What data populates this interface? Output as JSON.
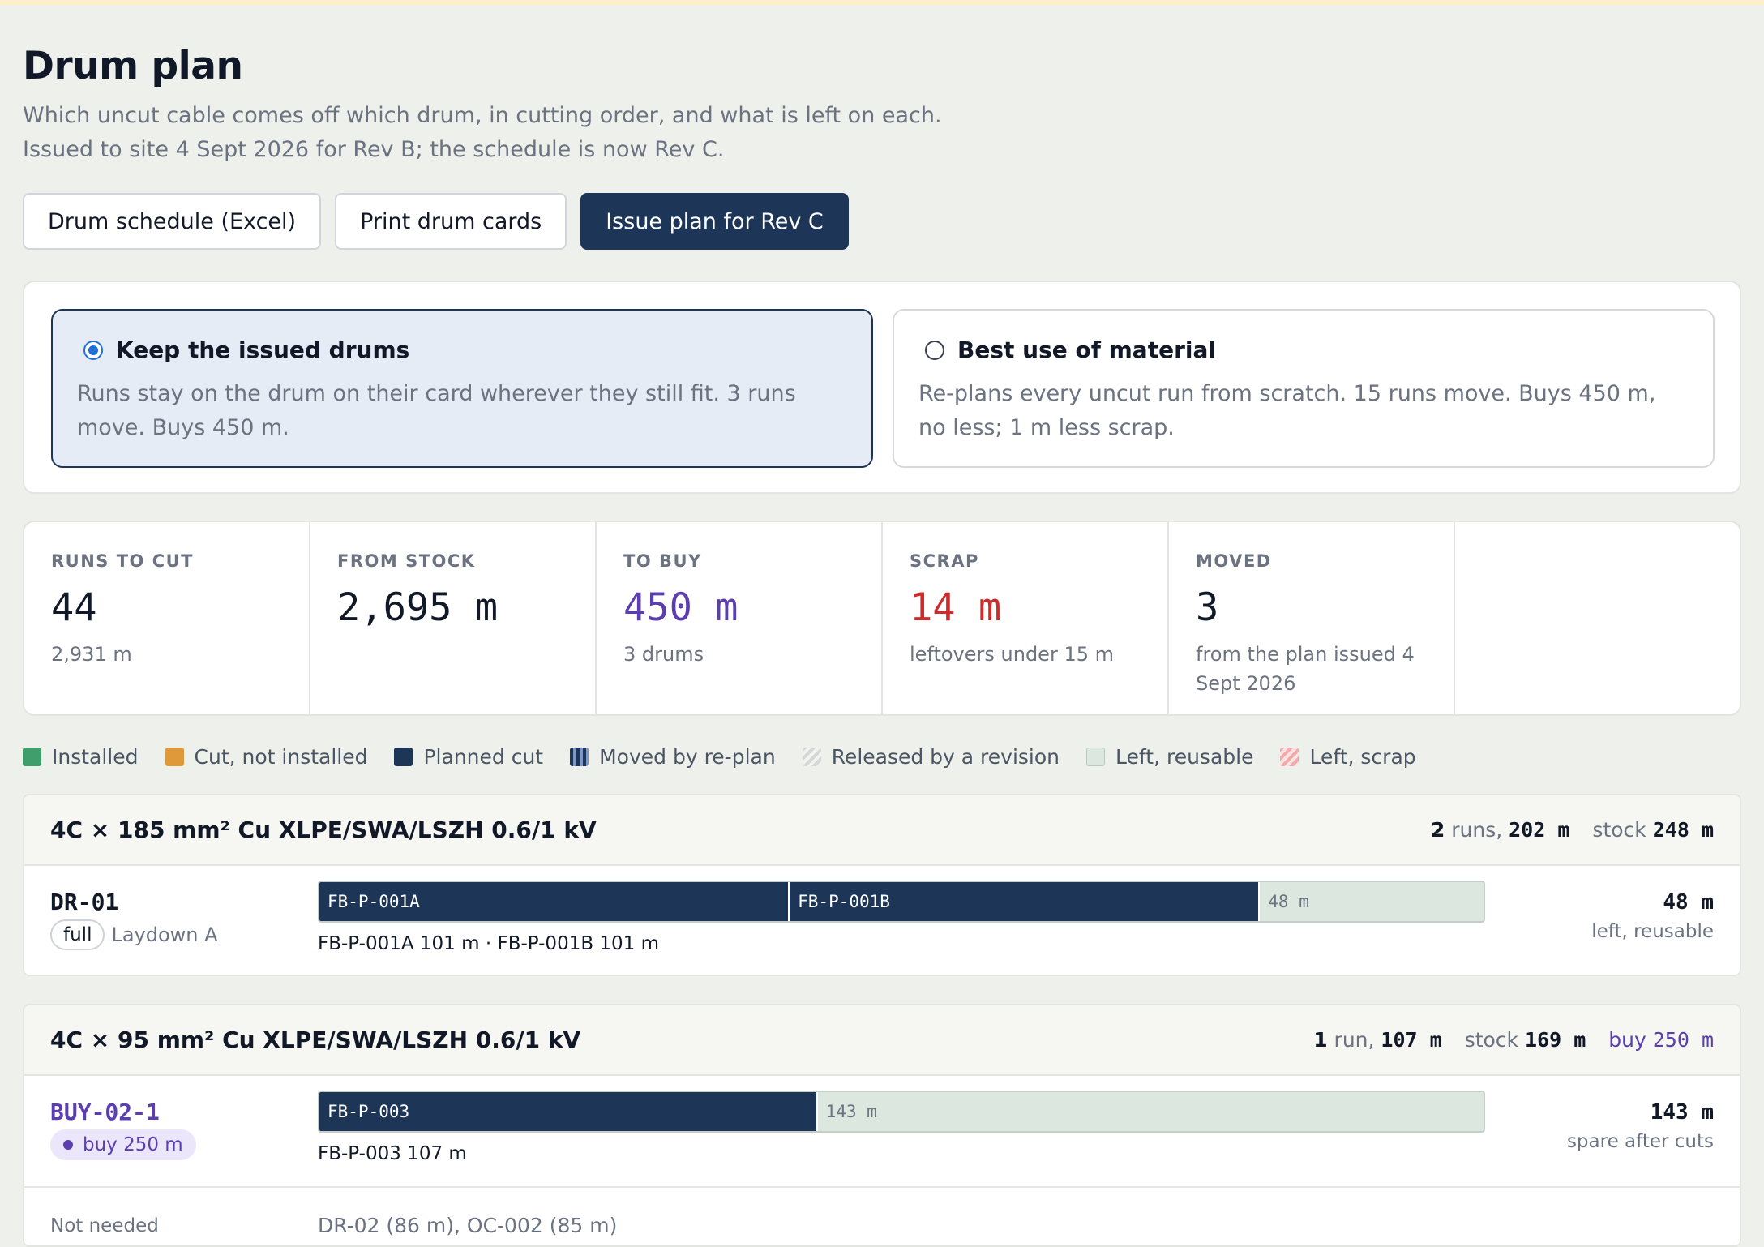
{
  "page": {
    "title": "Drum plan",
    "subtitle": "Which uncut cable comes off which drum, in cutting order, and what is left on each. Issued to site 4 Sept 2026 for Rev B; the schedule is now Rev C."
  },
  "actions": {
    "schedule_label": "Drum schedule (Excel)",
    "print_label": "Print drum cards",
    "issue_label": "Issue plan for Rev C"
  },
  "mode": {
    "keep": {
      "title": "Keep the issued drums",
      "desc": "Runs stay on the drum on their card wherever they still fit. 3 runs move. Buys 450 m.",
      "selected": true
    },
    "best": {
      "title": "Best use of material",
      "desc": "Re-plans every uncut run from scratch. 15 runs move. Buys 450 m, no less; 1 m less scrap.",
      "selected": false
    }
  },
  "stats": [
    {
      "label": "RUNS TO CUT",
      "value": "44",
      "sub": "2,931 m"
    },
    {
      "label": "FROM STOCK",
      "value": "2,695 m",
      "sub": ""
    },
    {
      "label": "TO BUY",
      "value": "450 m",
      "sub": "3 drums"
    },
    {
      "label": "SCRAP",
      "value": "14 m",
      "sub": "leftovers under 15 m"
    },
    {
      "label": "MOVED",
      "value": "3",
      "sub": "from the plan issued 4 Sept 2026"
    }
  ],
  "legend": [
    {
      "label": "Installed",
      "color": "#3f9e6b"
    },
    {
      "label": "Cut, not installed",
      "color": "#e0993a"
    },
    {
      "label": "Planned cut",
      "color": "#1d3557"
    },
    {
      "label": "Moved by re-plan",
      "color": "#7f97c6"
    },
    {
      "label": "Released by a revision",
      "color": "#d5d7d4"
    },
    {
      "label": "Left, reusable",
      "color": "#dce7df"
    },
    {
      "label": "Left, scrap",
      "color": "#f3a9a9"
    }
  ],
  "groups": [
    {
      "name": "4C × 185 mm² Cu XLPE/SWA/LSZH 0.6/1 kV",
      "runs_n": "2",
      "runs_word": "runs,",
      "runs_len": "202 m",
      "stock_word": "stock",
      "stock": "248 m",
      "drums": [
        {
          "id": "DR-01",
          "tag": "full",
          "location": "Laydown A",
          "capacity": 250,
          "cuts": [
            {
              "label": "FB-P-001A",
              "len": 101
            },
            {
              "label": "FB-P-001B",
              "len": 101
            }
          ],
          "left_label": "48 m",
          "caption": "FB-P-001A 101 m · FB-P-001B 101 m",
          "right_value": "48 m",
          "right_sub": "left, reusable"
        }
      ]
    },
    {
      "name": "4C × 95 mm² Cu XLPE/SWA/LSZH 0.6/1 kV",
      "runs_n": "1",
      "runs_word": "run,",
      "runs_len": "107 m",
      "stock_word": "stock",
      "stock": "169 m",
      "buy_word": "buy",
      "buy": "250 m",
      "drums": [
        {
          "id": "BUY-02-1",
          "tag": "buy 250 m",
          "capacity": 250,
          "cuts": [
            {
              "label": "FB-P-003",
              "len": 107
            }
          ],
          "left_label": "143 m",
          "caption": "FB-P-003 107 m",
          "right_value": "143 m",
          "right_sub": "spare after cuts"
        }
      ],
      "not_needed_label": "Not needed",
      "not_needed": "DR-02 (86 m), OC-002 (85 m)"
    }
  ]
}
